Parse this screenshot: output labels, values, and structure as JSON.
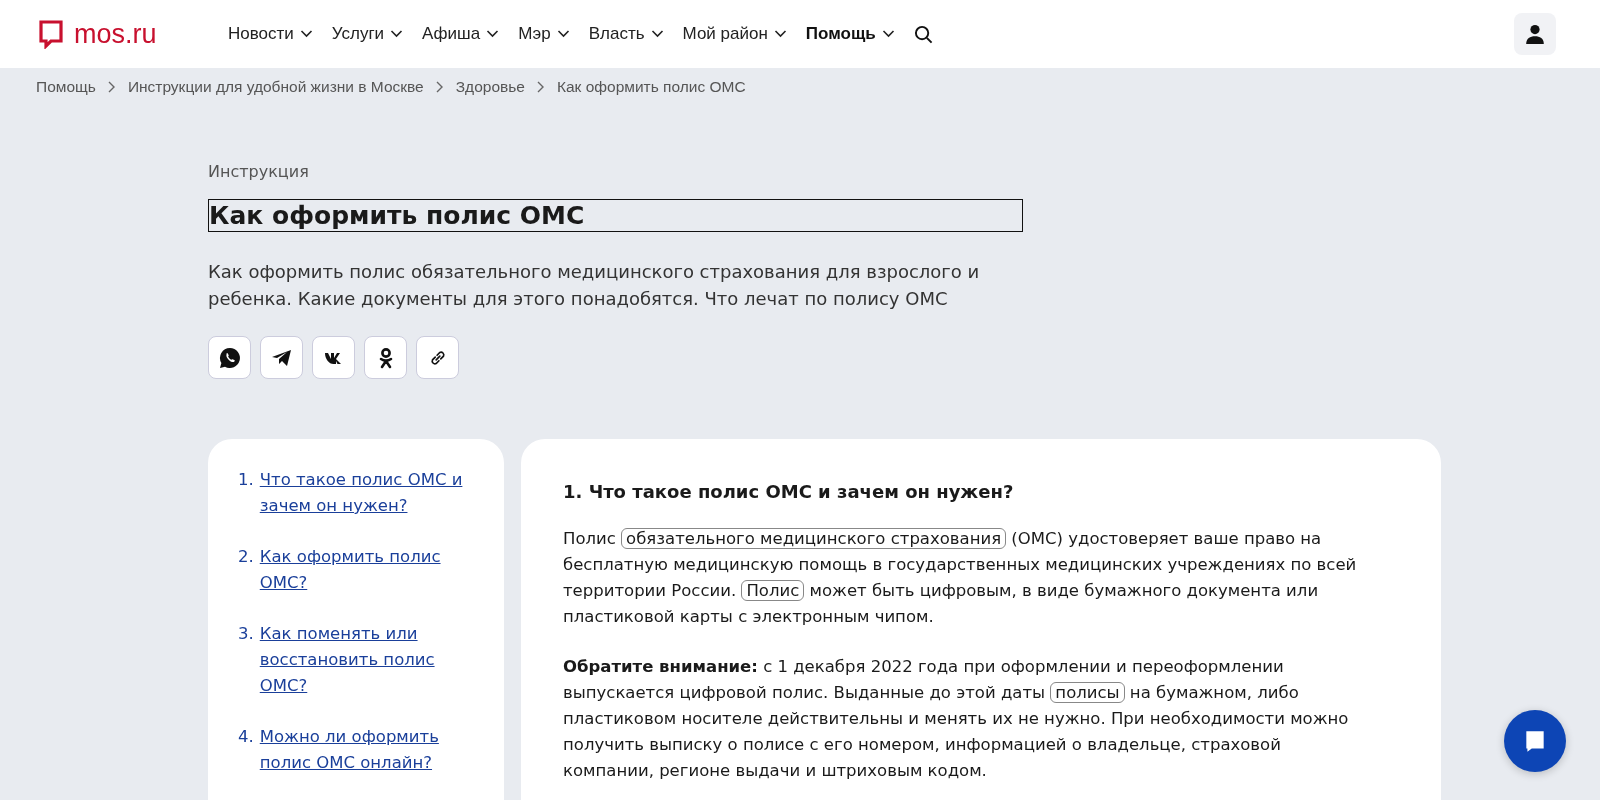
{
  "header": {
    "logo": "mos.ru",
    "nav": [
      {
        "label": "Новости",
        "selected": false
      },
      {
        "label": "Услуги",
        "selected": false
      },
      {
        "label": "Афиша",
        "selected": false
      },
      {
        "label": "Мэр",
        "selected": false
      },
      {
        "label": "Власть",
        "selected": false
      },
      {
        "label": "Мой район",
        "selected": false
      },
      {
        "label": "Помощь",
        "selected": true
      }
    ]
  },
  "breadcrumbs": [
    "Помощь",
    "Инструкции для удобной жизни в Москве",
    "Здоровье",
    "Как оформить полис ОМС"
  ],
  "article": {
    "kicker": "Инструкция",
    "title": "Как оформить полис ОМС",
    "lead": "Как оформить полис обязательного медицинского страхования для взрослого и ребенка. Какие документы для этого понадобятся. Что лечат по полису ОМС",
    "share": [
      {
        "kind": "whatsapp"
      },
      {
        "kind": "telegram"
      },
      {
        "kind": "vk"
      },
      {
        "kind": "ok"
      },
      {
        "kind": "link"
      }
    ]
  },
  "contents": [
    {
      "number": "1.",
      "label": "Что такое полис ОМС и зачем он нужен?"
    },
    {
      "number": "2.",
      "label": "Как оформить полис ОМС?"
    },
    {
      "number": "3.",
      "label": "Как поменять или восстановить полис ОМС?"
    },
    {
      "number": "4.",
      "label": "Можно ли оформить полис ОМС онлайн?"
    }
  ],
  "section": {
    "heading": "1. Что такое полис ОМС и зачем он нужен?",
    "paragraphs": [
      [
        {
          "kind": "text",
          "text": "Полис "
        },
        {
          "kind": "term",
          "text": "обязательного медицинского страхования"
        },
        {
          "kind": "text",
          "text": " (ОМС) удостоверяет ваше право на бесплатную медицинскую помощь в государственных медицинских учреждениях по всей территории России. "
        },
        {
          "kind": "term",
          "text": "Полис"
        },
        {
          "kind": "text",
          "text": " может быть цифровым, в виде бумажного документа или пластиковой карты с электронным чипом."
        }
      ],
      [
        {
          "kind": "text",
          "text": "**Обратите внимание:** с 1 декабря 2022 года при оформлении и переоформлении выпускается цифровой полис. Выданные до этой даты "
        },
        {
          "kind": "term",
          "text": "полисы"
        },
        {
          "kind": "text",
          "text": " на бумажном, либо пластиковом носителе действительны и менять их не нужно. При необходимости можно получить выписку о полисе с его номером, информацией о владельце, страховой компании, регионе выдачи и штриховым кодом."
        }
      ]
    ]
  }
}
